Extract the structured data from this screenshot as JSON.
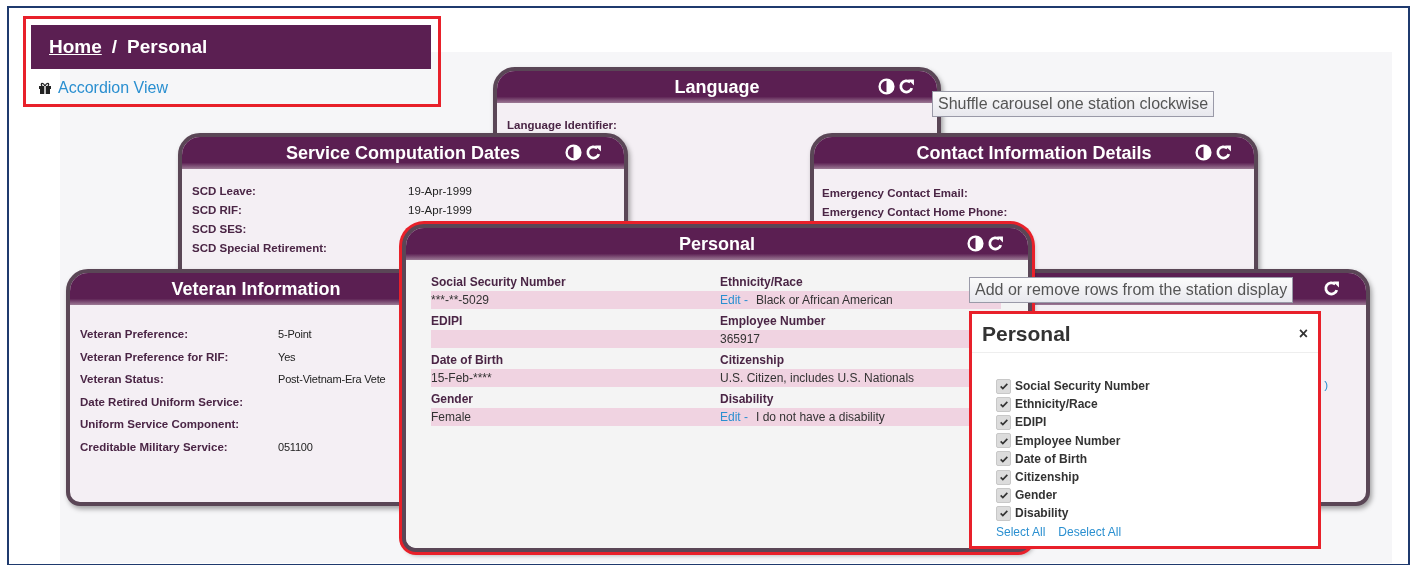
{
  "breadcrumb": {
    "home": "Home",
    "separator": "/",
    "current": "Personal"
  },
  "accordion_link": "Accordion View",
  "back_stations": [
    {
      "title": "Language",
      "rows": [
        {
          "label": "Language Identifier:"
        }
      ]
    },
    {
      "title": "Service Computation Dates",
      "rows": [
        {
          "label": "SCD Leave:",
          "value": "19-Apr-1999"
        },
        {
          "label": "SCD RIF:",
          "value": "19-Apr-1999"
        },
        {
          "label": "SCD SES:"
        },
        {
          "label": "SCD Special Retirement:"
        }
      ]
    },
    {
      "title": "Contact Information Details",
      "rows": [
        {
          "label": "Emergency Contact Email:"
        },
        {
          "label": "Emergency Contact Home Phone:"
        }
      ]
    },
    {
      "title": "Veteran Information",
      "rows": [
        {
          "label": "Veteran Preference:",
          "value": "5-Point"
        },
        {
          "label": "Veteran Preference for RIF:",
          "value": "Yes"
        },
        {
          "label": "Veteran Status:",
          "value": "Post-Vietnam-Era Vete"
        },
        {
          "label": "Date Retired Uniform Service:"
        },
        {
          "label": "Uniform Service Component:"
        },
        {
          "label": "Creditable Military Service:",
          "value": "051100"
        }
      ]
    },
    {
      "rows": [
        {
          "value": ")"
        }
      ]
    }
  ],
  "personal": {
    "title": "Personal",
    "fields": [
      {
        "label": "Social Security Number",
        "value": "***-**-5029"
      },
      {
        "label": "Ethnicity/Race",
        "link": "Edit -",
        "value": "Black or African American"
      },
      {
        "label": "EDIPI"
      },
      {
        "label": "Employee Number",
        "value": "365917"
      },
      {
        "label": "Date of Birth",
        "value": "15-Feb-****"
      },
      {
        "label": "Citizenship",
        "value": "U.S. Citizen, includes U.S. Nationals"
      },
      {
        "label": "Gender",
        "value": "Female"
      },
      {
        "label": "Disability",
        "link": "Edit -",
        "value": "I do not have a disability"
      }
    ]
  },
  "tooltips": [
    "Shuffle carousel one station clockwise",
    "Add or remove rows from the station display"
  ],
  "row_picker": {
    "title": "Personal",
    "close": "×",
    "options": [
      {
        "label": "Social Security Number",
        "checked": true
      },
      {
        "label": "Ethnicity/Race",
        "checked": true
      },
      {
        "label": "EDIPI",
        "checked": true
      },
      {
        "label": "Employee Number",
        "checked": true
      },
      {
        "label": "Date of Birth",
        "checked": true
      },
      {
        "label": "Citizenship",
        "checked": true
      },
      {
        "label": "Gender",
        "checked": true
      },
      {
        "label": "Disability",
        "checked": true
      }
    ],
    "actions": [
      "Select All",
      "Deselect All"
    ]
  }
}
